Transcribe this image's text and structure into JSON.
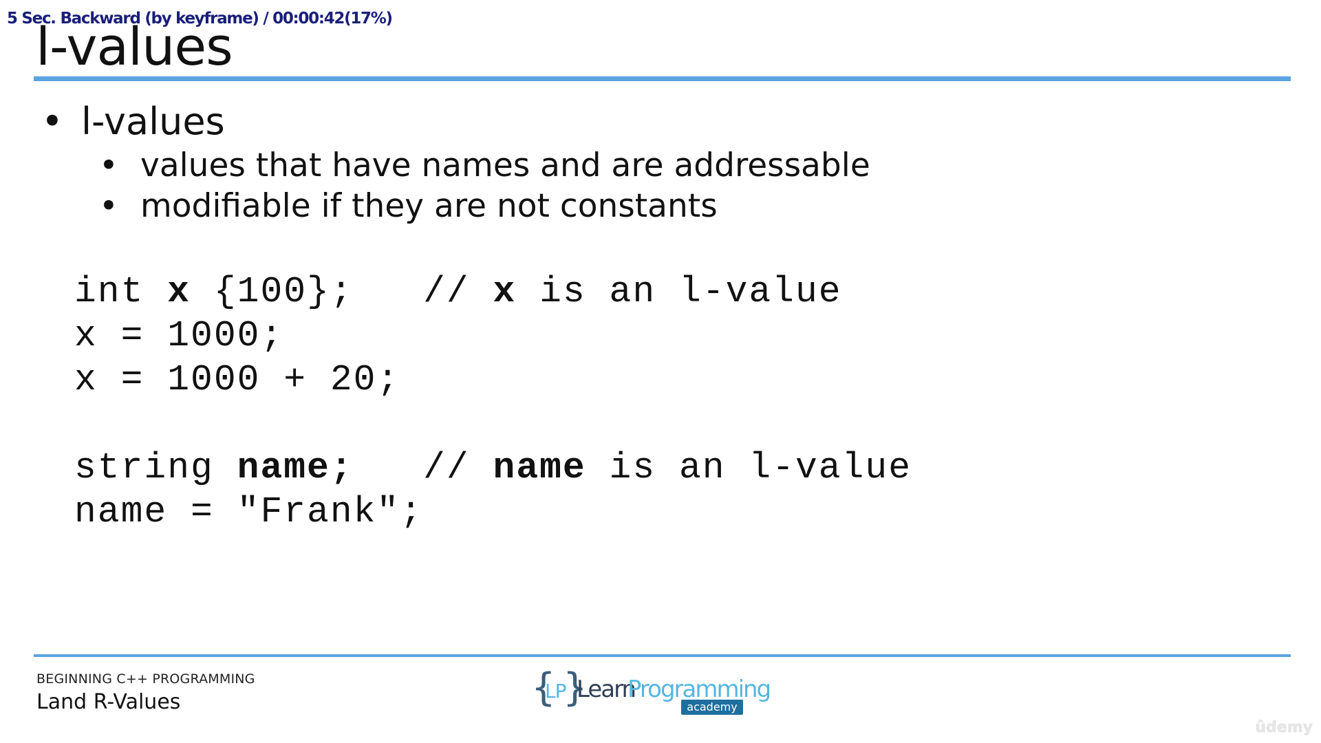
{
  "player": {
    "osd_text": "5 Sec. Backward (by keyframe) / 00:00:42(17%)"
  },
  "slide": {
    "title": "l-values",
    "bullet": "l-values",
    "sub_bullets": [
      "values that have names and are addressable",
      "modifiable if they are not constants"
    ],
    "bullet_glyph": "•",
    "code": {
      "line1_a": "int ",
      "line1_b": "x",
      "line1_c": " {100};   // ",
      "line1_d": "x",
      "line1_e": " is an l-value",
      "line2": "x = 1000;",
      "line3": "x = 1000 + 20;",
      "line4_a": "string ",
      "line4_b": "name;",
      "line4_c": "   // ",
      "line4_d": "name",
      "line4_e": " is an l-value",
      "line5": "name = \"Frank\";"
    }
  },
  "footer": {
    "course": "BEGINNING C++ PROGRAMMING",
    "lesson": "Land R-Values",
    "logo": {
      "brace_open": "{",
      "lp": "LP",
      "brace_close": "}",
      "learn": "Learn",
      "programming": "Programming",
      "academy": "academy"
    }
  },
  "watermark": "ûdemy",
  "colors": {
    "accent_rule": "#5ba3de",
    "osd_text": "#1a1f7a",
    "text": "#111111"
  }
}
